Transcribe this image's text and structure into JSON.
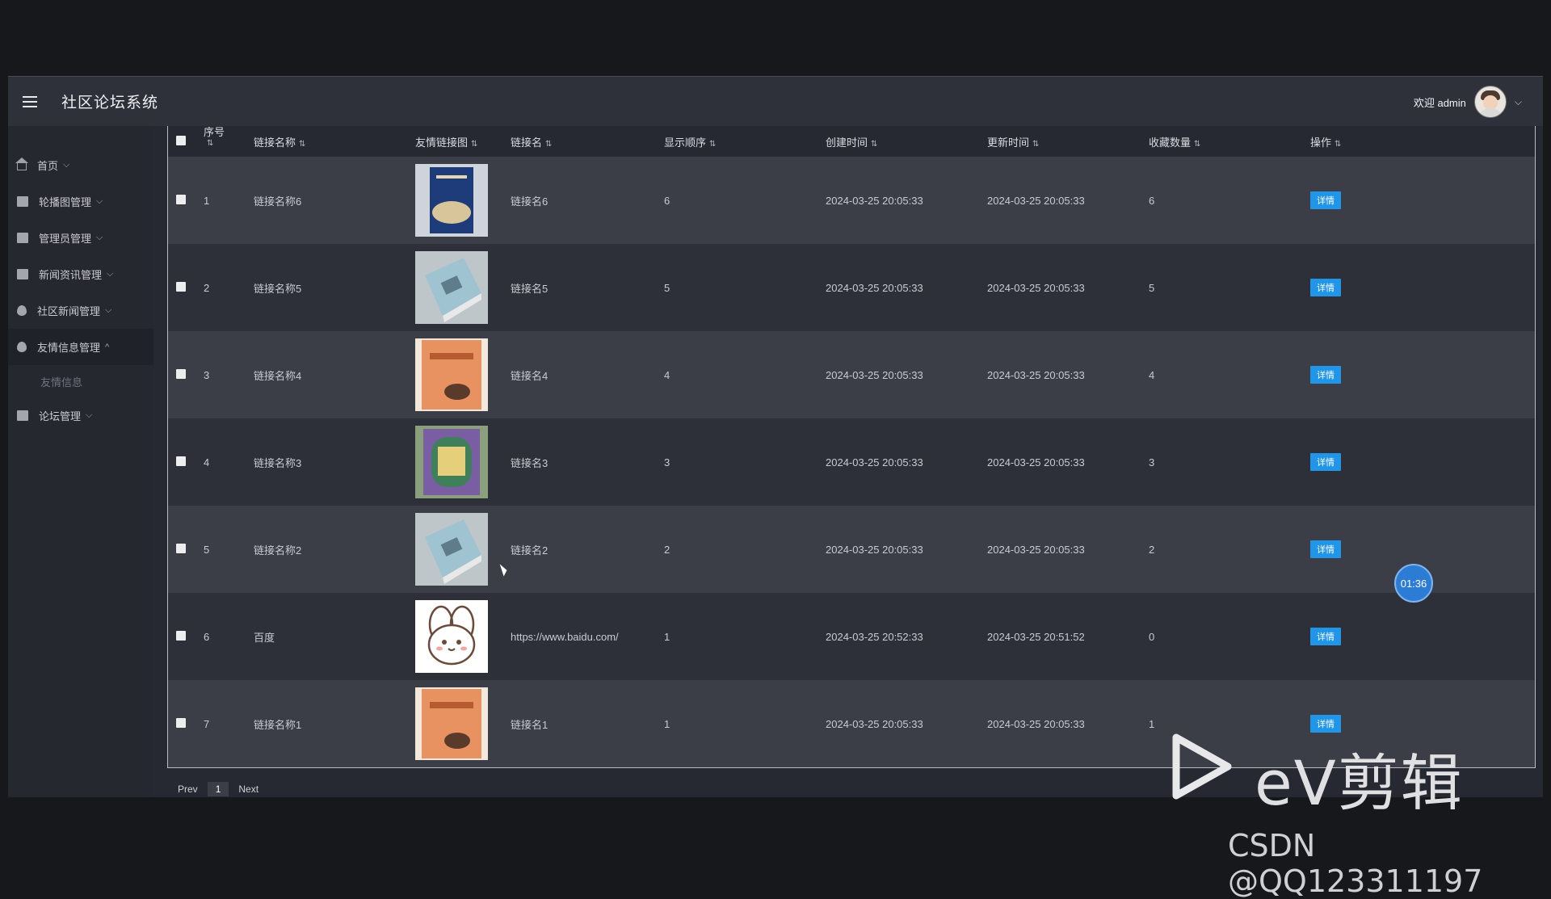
{
  "header": {
    "title": "社区论坛系统",
    "welcome": "欢迎 admin"
  },
  "sidebar": {
    "items": [
      {
        "label": "首页",
        "icon": "home-icon",
        "caret": "⌵"
      },
      {
        "label": "轮播图管理",
        "icon": "carousel-icon",
        "caret": "⌵"
      },
      {
        "label": "管理员管理",
        "icon": "admin-icon",
        "caret": "⌵"
      },
      {
        "label": "新闻资讯管理",
        "icon": "news-icon",
        "caret": "⌵"
      },
      {
        "label": "社区新闻管理",
        "icon": "community-icon",
        "caret": "⌵"
      },
      {
        "label": "友情信息管理",
        "icon": "friend-link-icon",
        "caret": "^"
      }
    ],
    "sub_item": "友情信息",
    "last_item": {
      "label": "论坛管理",
      "icon": "forum-icon",
      "caret": "⌵"
    }
  },
  "table": {
    "columns": [
      "序号",
      "链接名称",
      "友情链接图",
      "链接名",
      "显示顺序",
      "创建时间",
      "更新时间",
      "收藏数量",
      "操作"
    ],
    "rows": [
      {
        "index": "1",
        "name": "链接名称6",
        "thumb": "book-navy",
        "link": "链接名6",
        "order": "6",
        "created": "2024-03-25 20:05:33",
        "updated": "2024-03-25 20:05:33",
        "favorites": "6",
        "action": "详情"
      },
      {
        "index": "2",
        "name": "链接名称5",
        "thumb": "book-blue",
        "link": "链接名5",
        "order": "5",
        "created": "2024-03-25 20:05:33",
        "updated": "2024-03-25 20:05:33",
        "favorites": "5",
        "action": "详情"
      },
      {
        "index": "3",
        "name": "链接名称4",
        "thumb": "book-orange",
        "link": "链接名4",
        "order": "4",
        "created": "2024-03-25 20:05:33",
        "updated": "2024-03-25 20:05:33",
        "favorites": "4",
        "action": "详情"
      },
      {
        "index": "4",
        "name": "链接名称3",
        "thumb": "book-ornate",
        "link": "链接名3",
        "order": "3",
        "created": "2024-03-25 20:05:33",
        "updated": "2024-03-25 20:05:33",
        "favorites": "3",
        "action": "详情"
      },
      {
        "index": "5",
        "name": "链接名称2",
        "thumb": "book-blue",
        "link": "链接名2",
        "order": "2",
        "created": "2024-03-25 20:05:33",
        "updated": "2024-03-25 20:05:33",
        "favorites": "2",
        "action": "详情"
      },
      {
        "index": "6",
        "name": "百度",
        "thumb": "cartoon-bunny",
        "link": "https://www.baidu.com/",
        "order": "1",
        "created": "2024-03-25 20:52:33",
        "updated": "2024-03-25 20:51:52",
        "favorites": "0",
        "action": "详情"
      },
      {
        "index": "7",
        "name": "链接名称1",
        "thumb": "book-orange",
        "link": "链接名1",
        "order": "1",
        "created": "2024-03-25 20:05:33",
        "updated": "2024-03-25 20:05:33",
        "favorites": "1",
        "action": "详情"
      }
    ]
  },
  "pagination": {
    "prev": "Prev",
    "current": "1",
    "next": "Next"
  },
  "timer": "01:36",
  "watermark": {
    "brand": "eV剪辑",
    "credit": "CSDN @QQ123311197"
  },
  "colors": {
    "accent": "#2196e9",
    "header_bg": "#2e3139",
    "sidebar_bg": "#25282f"
  }
}
